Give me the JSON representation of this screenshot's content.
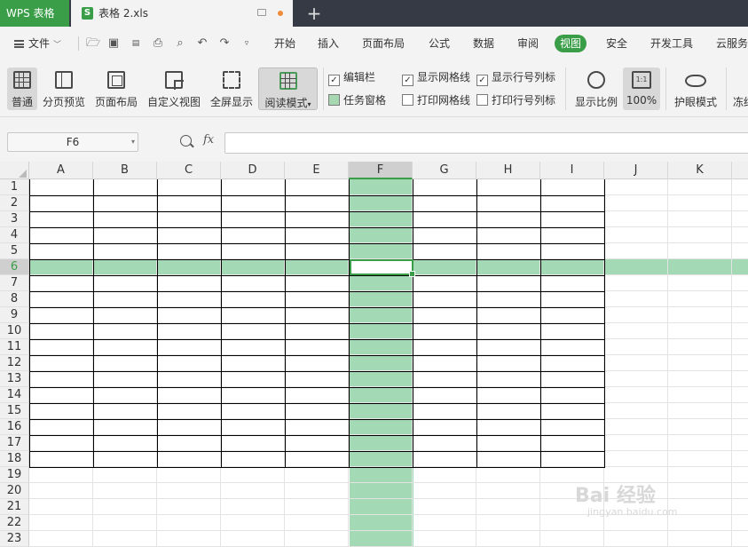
{
  "titlebar": {
    "app_tab": "WPS 表格",
    "doc_tab_icon": "S",
    "doc_tab": "表格 2.xls",
    "new_tab": "+"
  },
  "menubar": {
    "file": "文件",
    "tabs": [
      "开始",
      "插入",
      "页面布局",
      "公式",
      "数据",
      "审阅",
      "视图",
      "安全",
      "开发工具",
      "云服务"
    ],
    "active_tab": "视图"
  },
  "ribbon": {
    "buttons": [
      {
        "label": "普通",
        "icon": "normal-view-icon",
        "selected": true
      },
      {
        "label": "分页预览",
        "icon": "page-break-preview-icon"
      },
      {
        "label": "页面布局",
        "icon": "page-layout-icon"
      },
      {
        "label": "自定义视图",
        "icon": "custom-view-icon"
      },
      {
        "label": "全屏显示",
        "icon": "fullscreen-icon"
      },
      {
        "label": "阅读模式",
        "icon": "reading-mode-icon",
        "selected": true
      }
    ],
    "checkboxes": [
      {
        "label": "编辑栏",
        "checked": true
      },
      {
        "label": "任务窗格",
        "checked": false,
        "style": "green"
      },
      {
        "label": "显示网格线",
        "checked": true
      },
      {
        "label": "打印网格线",
        "checked": false
      },
      {
        "label": "显示行号列标",
        "checked": true
      },
      {
        "label": "打印行号列标",
        "checked": false
      }
    ],
    "zoom_label": "显示比例",
    "zoom_100_icon_text": "1:1",
    "zoom_100_label": "100%",
    "eye_label": "护眼模式",
    "freeze_label": "冻结"
  },
  "formula_bar": {
    "name_box": "F6",
    "fx": "fx",
    "formula": ""
  },
  "sheet": {
    "columns": [
      "A",
      "B",
      "C",
      "D",
      "E",
      "F",
      "G",
      "H",
      "I",
      "J",
      "K"
    ],
    "rows": [
      "1",
      "2",
      "3",
      "4",
      "5",
      "6",
      "7",
      "8",
      "9",
      "10",
      "11",
      "12",
      "13",
      "14",
      "15",
      "16",
      "17",
      "18",
      "19",
      "20",
      "21",
      "22",
      "23"
    ],
    "active_cell": "F6",
    "highlight_color": "#a3d9b5",
    "accent": "#3a9e48"
  },
  "watermark": {
    "text": "Bai  经验",
    "sub": "jingyan.baidu.com"
  }
}
